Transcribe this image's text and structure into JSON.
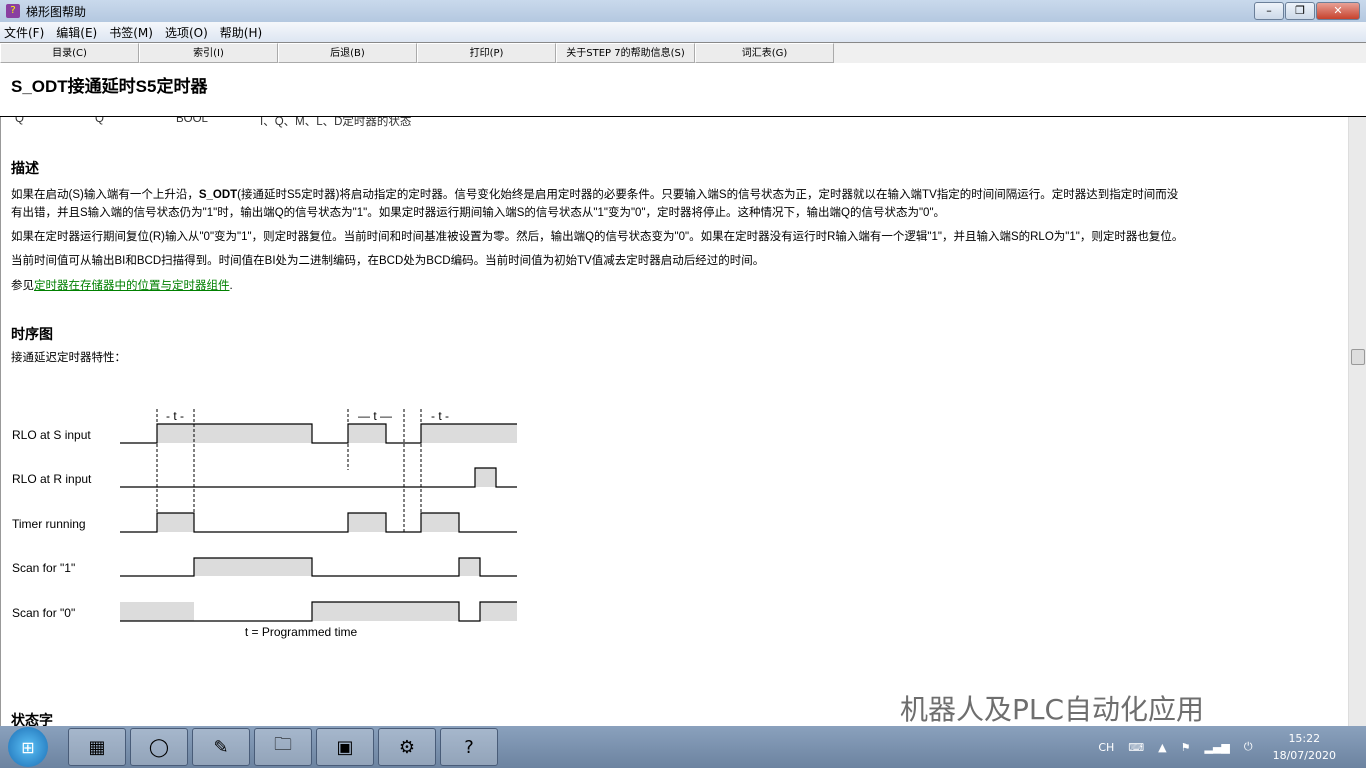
{
  "window": {
    "title": "梯形图帮助"
  },
  "menu": [
    "文件(F)",
    "编辑(E)",
    "书签(M)",
    "选项(O)",
    "帮助(H)"
  ],
  "buttons": [
    "目录(C)",
    "索引(I)",
    "后退(B)",
    "打印(P)",
    "关于STEP 7的帮助信息(S)",
    "词汇表(G)"
  ],
  "page": {
    "title": "S_ODT接通延时S5定时器",
    "table_row": [
      "Q",
      "Q",
      "BOOL",
      "I、Q、M、L、D定时器的状态"
    ],
    "desc_heading": "描述",
    "p1a": "如果在启动(S)输入端有一个上升沿，",
    "p1b": "S_ODT",
    "p1c": "(接通延时S5定时器)将启动指定的定时器。信号变化始终是启用定时器的必要条件。只要输入端S的信号状态为正，定时器就以在输入端TV指定的时间间隔运行。定时器达到指定时间而没",
    "p1d": "有出错，并且S输入端的信号状态仍为\"1\"时，输出端Q的信号状态为\"1\"。如果定时器运行期间输入端S的信号状态从\"1\"变为\"0\"，定时器将停止。这种情况下，输出端Q的信号状态为\"0\"。",
    "p2": "如果在定时器运行期间复位(R)输入从\"0\"变为\"1\"，则定时器复位。当前时间和时间基准被设置为零。然后，输出端Q的信号状态变为\"0\"。如果在定时器没有运行时R输入端有一个逻辑\"1\"，并且输入端S的RLO为\"1\"，则定时器也复位。",
    "p3": "当前时间值可从输出BI和BCD扫描得到。时间值在BI处为二进制编码，在BCD处为BCD编码。当前时间值为初始TV值减去定时器启动后经过的时间。",
    "see_prefix": "参见",
    "see_link": "定时器在存储器中的位置与定时器组件",
    "see_suffix": ".",
    "timing_heading": "时序图",
    "timing_sub": "接通延迟定时器特性：",
    "status_heading": "状态字"
  },
  "diagram": {
    "rows": [
      "RLO at S input",
      "RLO at R input",
      "Timer running",
      "Scan for \"1\"",
      "Scan for \"0\""
    ],
    "t_labels": [
      "- t -",
      "— t —",
      "- t -"
    ],
    "footnote": "t = Programmed time"
  },
  "tray": {
    "lang": "CH",
    "time": "15:22",
    "date": "18/07/2020"
  },
  "watermark": "机器人及PLC自动化应用"
}
